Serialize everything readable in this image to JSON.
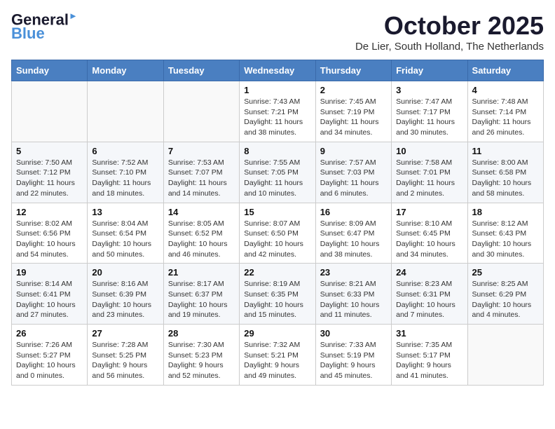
{
  "header": {
    "logo_line1": "General",
    "logo_line2": "Blue",
    "month_title": "October 2025",
    "location": "De Lier, South Holland, The Netherlands"
  },
  "days_of_week": [
    "Sunday",
    "Monday",
    "Tuesday",
    "Wednesday",
    "Thursday",
    "Friday",
    "Saturday"
  ],
  "weeks": [
    [
      {
        "day": "",
        "info": ""
      },
      {
        "day": "",
        "info": ""
      },
      {
        "day": "",
        "info": ""
      },
      {
        "day": "1",
        "info": "Sunrise: 7:43 AM\nSunset: 7:21 PM\nDaylight: 11 hours\nand 38 minutes."
      },
      {
        "day": "2",
        "info": "Sunrise: 7:45 AM\nSunset: 7:19 PM\nDaylight: 11 hours\nand 34 minutes."
      },
      {
        "day": "3",
        "info": "Sunrise: 7:47 AM\nSunset: 7:17 PM\nDaylight: 11 hours\nand 30 minutes."
      },
      {
        "day": "4",
        "info": "Sunrise: 7:48 AM\nSunset: 7:14 PM\nDaylight: 11 hours\nand 26 minutes."
      }
    ],
    [
      {
        "day": "5",
        "info": "Sunrise: 7:50 AM\nSunset: 7:12 PM\nDaylight: 11 hours\nand 22 minutes."
      },
      {
        "day": "6",
        "info": "Sunrise: 7:52 AM\nSunset: 7:10 PM\nDaylight: 11 hours\nand 18 minutes."
      },
      {
        "day": "7",
        "info": "Sunrise: 7:53 AM\nSunset: 7:07 PM\nDaylight: 11 hours\nand 14 minutes."
      },
      {
        "day": "8",
        "info": "Sunrise: 7:55 AM\nSunset: 7:05 PM\nDaylight: 11 hours\nand 10 minutes."
      },
      {
        "day": "9",
        "info": "Sunrise: 7:57 AM\nSunset: 7:03 PM\nDaylight: 11 hours\nand 6 minutes."
      },
      {
        "day": "10",
        "info": "Sunrise: 7:58 AM\nSunset: 7:01 PM\nDaylight: 11 hours\nand 2 minutes."
      },
      {
        "day": "11",
        "info": "Sunrise: 8:00 AM\nSunset: 6:58 PM\nDaylight: 10 hours\nand 58 minutes."
      }
    ],
    [
      {
        "day": "12",
        "info": "Sunrise: 8:02 AM\nSunset: 6:56 PM\nDaylight: 10 hours\nand 54 minutes."
      },
      {
        "day": "13",
        "info": "Sunrise: 8:04 AM\nSunset: 6:54 PM\nDaylight: 10 hours\nand 50 minutes."
      },
      {
        "day": "14",
        "info": "Sunrise: 8:05 AM\nSunset: 6:52 PM\nDaylight: 10 hours\nand 46 minutes."
      },
      {
        "day": "15",
        "info": "Sunrise: 8:07 AM\nSunset: 6:50 PM\nDaylight: 10 hours\nand 42 minutes."
      },
      {
        "day": "16",
        "info": "Sunrise: 8:09 AM\nSunset: 6:47 PM\nDaylight: 10 hours\nand 38 minutes."
      },
      {
        "day": "17",
        "info": "Sunrise: 8:10 AM\nSunset: 6:45 PM\nDaylight: 10 hours\nand 34 minutes."
      },
      {
        "day": "18",
        "info": "Sunrise: 8:12 AM\nSunset: 6:43 PM\nDaylight: 10 hours\nand 30 minutes."
      }
    ],
    [
      {
        "day": "19",
        "info": "Sunrise: 8:14 AM\nSunset: 6:41 PM\nDaylight: 10 hours\nand 27 minutes."
      },
      {
        "day": "20",
        "info": "Sunrise: 8:16 AM\nSunset: 6:39 PM\nDaylight: 10 hours\nand 23 minutes."
      },
      {
        "day": "21",
        "info": "Sunrise: 8:17 AM\nSunset: 6:37 PM\nDaylight: 10 hours\nand 19 minutes."
      },
      {
        "day": "22",
        "info": "Sunrise: 8:19 AM\nSunset: 6:35 PM\nDaylight: 10 hours\nand 15 minutes."
      },
      {
        "day": "23",
        "info": "Sunrise: 8:21 AM\nSunset: 6:33 PM\nDaylight: 10 hours\nand 11 minutes."
      },
      {
        "day": "24",
        "info": "Sunrise: 8:23 AM\nSunset: 6:31 PM\nDaylight: 10 hours\nand 7 minutes."
      },
      {
        "day": "25",
        "info": "Sunrise: 8:25 AM\nSunset: 6:29 PM\nDaylight: 10 hours\nand 4 minutes."
      }
    ],
    [
      {
        "day": "26",
        "info": "Sunrise: 7:26 AM\nSunset: 5:27 PM\nDaylight: 10 hours\nand 0 minutes."
      },
      {
        "day": "27",
        "info": "Sunrise: 7:28 AM\nSunset: 5:25 PM\nDaylight: 9 hours\nand 56 minutes."
      },
      {
        "day": "28",
        "info": "Sunrise: 7:30 AM\nSunset: 5:23 PM\nDaylight: 9 hours\nand 52 minutes."
      },
      {
        "day": "29",
        "info": "Sunrise: 7:32 AM\nSunset: 5:21 PM\nDaylight: 9 hours\nand 49 minutes."
      },
      {
        "day": "30",
        "info": "Sunrise: 7:33 AM\nSunset: 5:19 PM\nDaylight: 9 hours\nand 45 minutes."
      },
      {
        "day": "31",
        "info": "Sunrise: 7:35 AM\nSunset: 5:17 PM\nDaylight: 9 hours\nand 41 minutes."
      },
      {
        "day": "",
        "info": ""
      }
    ]
  ]
}
